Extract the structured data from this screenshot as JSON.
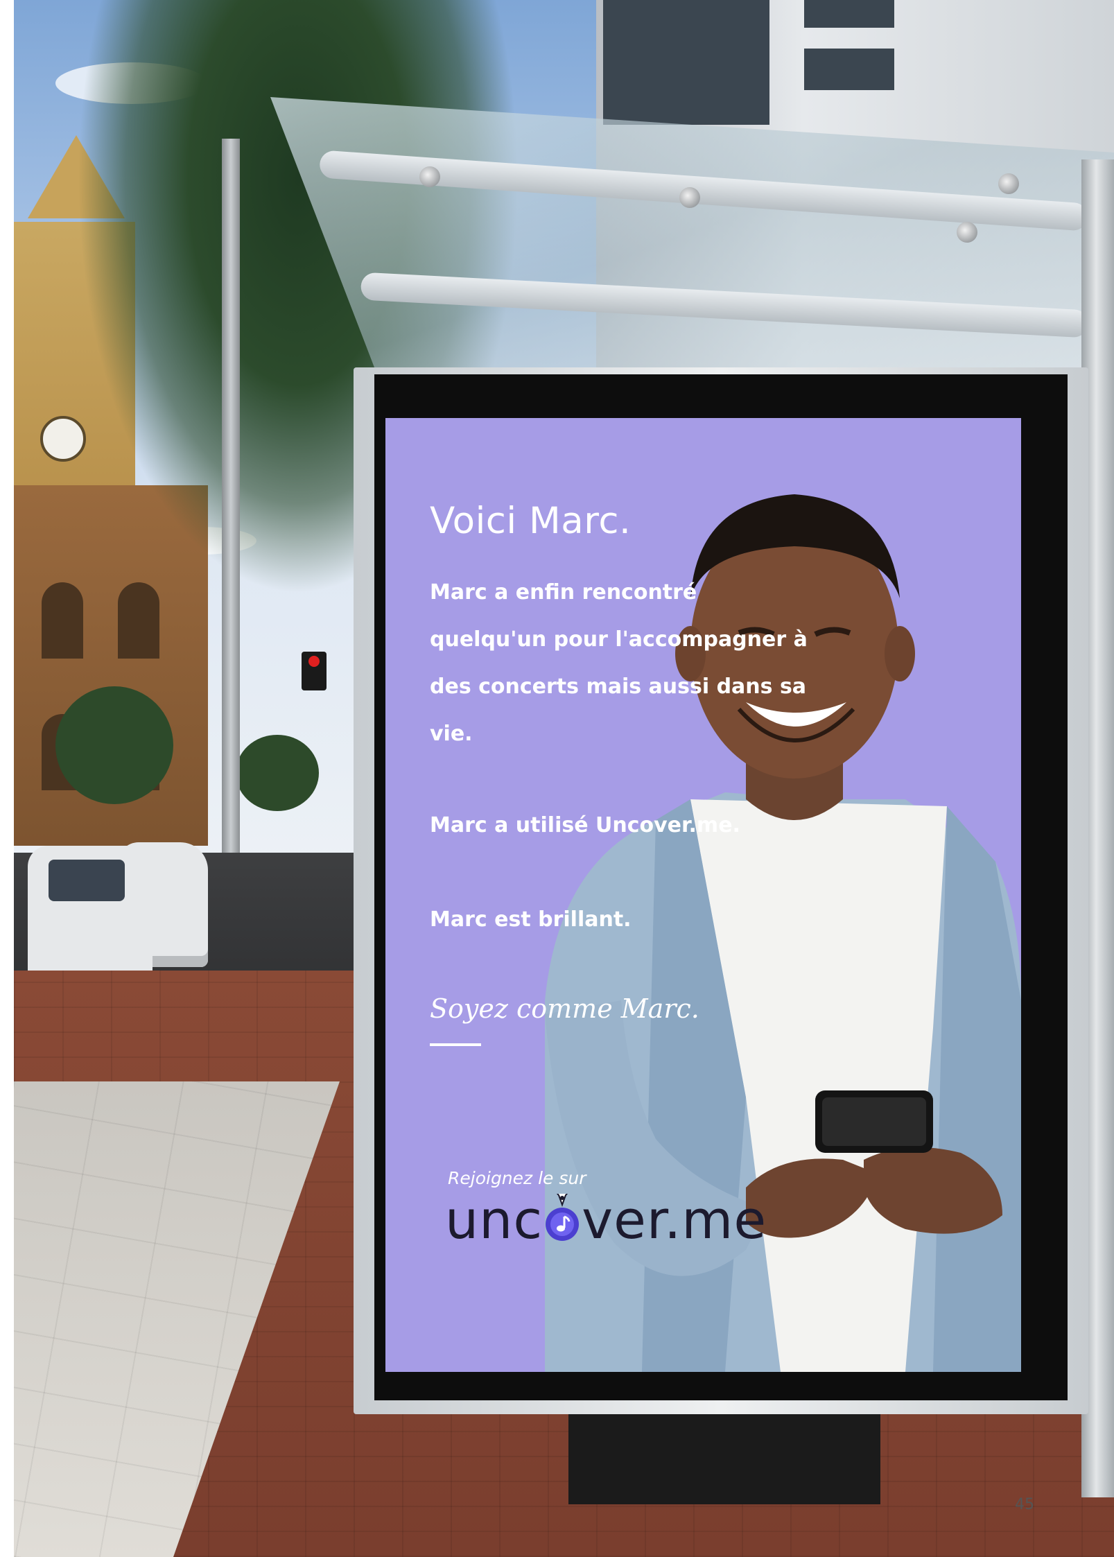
{
  "poster": {
    "headline": "Voici Marc.",
    "story": "Marc a enfin rencontré quelqu'un pour l'accompagner à des concerts mais aussi dans sa vie.",
    "line_used": "Marc a utilisé Uncover.me.",
    "line_brilliant": "Marc est brillant.",
    "tagline": "Soyez comme Marc.",
    "join_text": "Rejoignez le sur",
    "logo_part1": "unc",
    "logo_part2": "ver.me",
    "background_color": "#a69ce6",
    "logo_icon": "music-note-location-pin-icon"
  },
  "page_number": "45"
}
